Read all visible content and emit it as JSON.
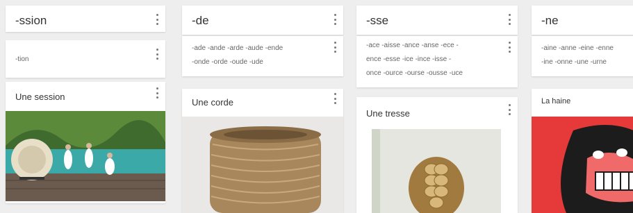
{
  "columns": [
    {
      "header": "-ssion",
      "suffix_lines": [
        "-tion"
      ],
      "example": "Une session"
    },
    {
      "header": "-de",
      "suffix_lines": [
        "-ade -ande -arde -aude  -ende",
        "-onde -orde -oude  -ude"
      ],
      "example": "Une corde"
    },
    {
      "header": "-sse",
      "suffix_lines": [
        "-ace -aisse -ance -anse -ece -",
        "ence -esse -ice  -ince -isse -",
        "once -ource -ourse -ousse  -uce"
      ],
      "example": "Une tresse"
    },
    {
      "header": "-ne",
      "suffix_lines": [
        "-aine -anne -eine -enne",
        "-ine -onne -une -urne"
      ],
      "example": "La haine"
    }
  ],
  "icons": {
    "menu": "more-vert-icon"
  }
}
